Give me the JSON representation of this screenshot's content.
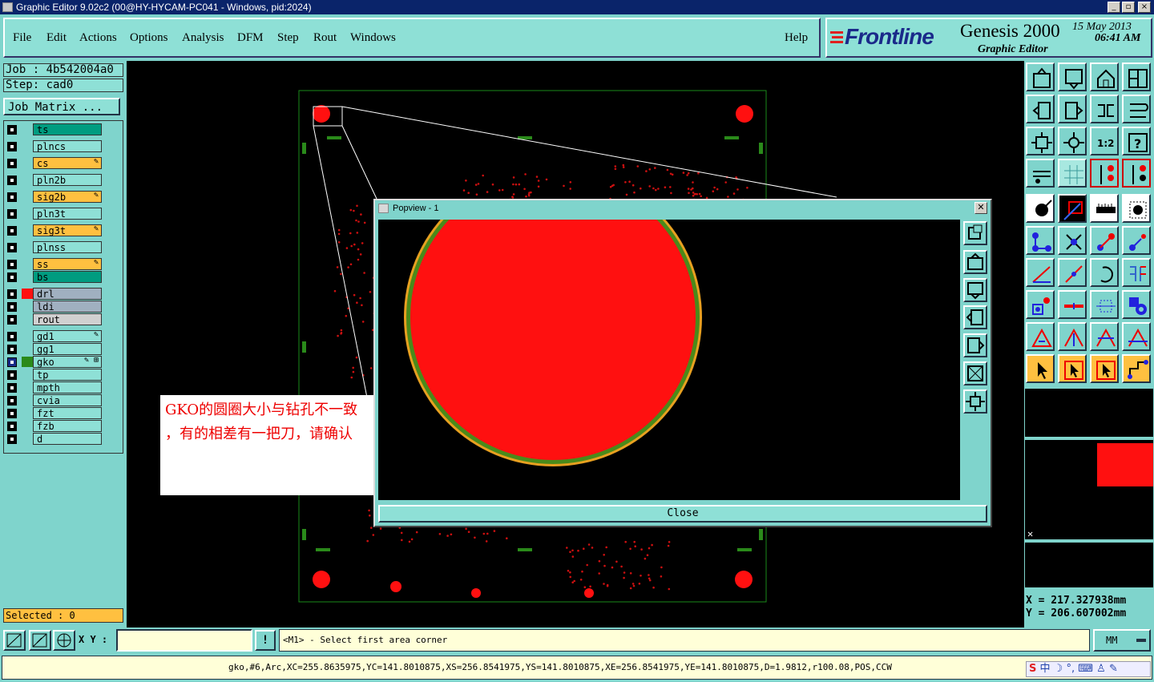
{
  "window": {
    "title": "Graphic Editor 9.02c2 (00@HY-HYCAM-PC041 - Windows, pid:2024)"
  },
  "menu": {
    "items": [
      "File",
      "Edit",
      "Actions",
      "Options",
      "Analysis",
      "DFM",
      "Step",
      "Rout",
      "Windows"
    ],
    "help": "Help"
  },
  "brand": {
    "logo": "Frontline",
    "product": "Genesis 2000",
    "subtitle": "Graphic Editor",
    "date": "15 May 2013",
    "time": "06:41 AM"
  },
  "job": {
    "job_label": "Job : 4b542004a0",
    "step_label": "Step: cad0",
    "matrix_button": "Job Matrix ..."
  },
  "layers": [
    {
      "name": "ts",
      "color": "#009c80",
      "marker": ""
    },
    {
      "name": "plncs",
      "color": "#8ee0d6",
      "marker": ""
    },
    {
      "name": "cs",
      "color": "#ffc040",
      "marker": "✎"
    },
    {
      "name": "pln2b",
      "color": "#8ee0d6",
      "marker": ""
    },
    {
      "name": "sig2b",
      "color": "#ffc040",
      "marker": "✎"
    },
    {
      "name": "pln3t",
      "color": "#8ee0d6",
      "marker": ""
    },
    {
      "name": "sig3t",
      "color": "#ffc040",
      "marker": "✎"
    },
    {
      "name": "plnss",
      "color": "#8ee0d6",
      "marker": ""
    },
    {
      "name": "ss",
      "color": "#ffc040",
      "marker": "✎"
    },
    {
      "name": "bs",
      "color": "#009c80",
      "marker": ""
    },
    {
      "name": "drl",
      "color": "#a0b0c0",
      "marker": ""
    },
    {
      "name": "ldi",
      "color": "#a0b0c0",
      "marker": ""
    },
    {
      "name": "rout",
      "color": "#d0d0d0",
      "marker": ""
    },
    {
      "name": "gd1",
      "color": "#8ee0d6",
      "marker": "✎"
    },
    {
      "name": "gg1",
      "color": "#8ee0d6",
      "marker": ""
    },
    {
      "name": "gko",
      "color": "#8ee0d6",
      "marker": "✎ ⊞"
    },
    {
      "name": "tp",
      "color": "#8ee0d6",
      "marker": ""
    },
    {
      "name": "mpth",
      "color": "#8ee0d6",
      "marker": ""
    },
    {
      "name": "cvia",
      "color": "#8ee0d6",
      "marker": ""
    },
    {
      "name": "fzt",
      "color": "#8ee0d6",
      "marker": ""
    },
    {
      "name": "fzb",
      "color": "#8ee0d6",
      "marker": ""
    },
    {
      "name": "d",
      "color": "#8ee0d6",
      "marker": ""
    }
  ],
  "selected_label": "Selected : 0",
  "popview": {
    "title": "Popview - 1",
    "close": "Close"
  },
  "note": {
    "line1": "GKO的圆圈大小与钻孔不一致",
    "line2": "，有的相差有一把刀，请确认"
  },
  "coords": {
    "x": "X  =  217.327938mm",
    "y": "Y  =  206.607002mm"
  },
  "prompt": {
    "xy_label": "X Y :",
    "xy_value": "",
    "message": "<M1> - Select first area corner",
    "units": "MM"
  },
  "status_line": "gko,#6,Arc,XC=255.8635975,YC=141.8010875,XS=256.8541975,YS=141.8010875,XE=256.8541975,YE=141.8010875,D=1.9812,r100.08,POS,CCW",
  "tray": {
    "ime": "中"
  }
}
